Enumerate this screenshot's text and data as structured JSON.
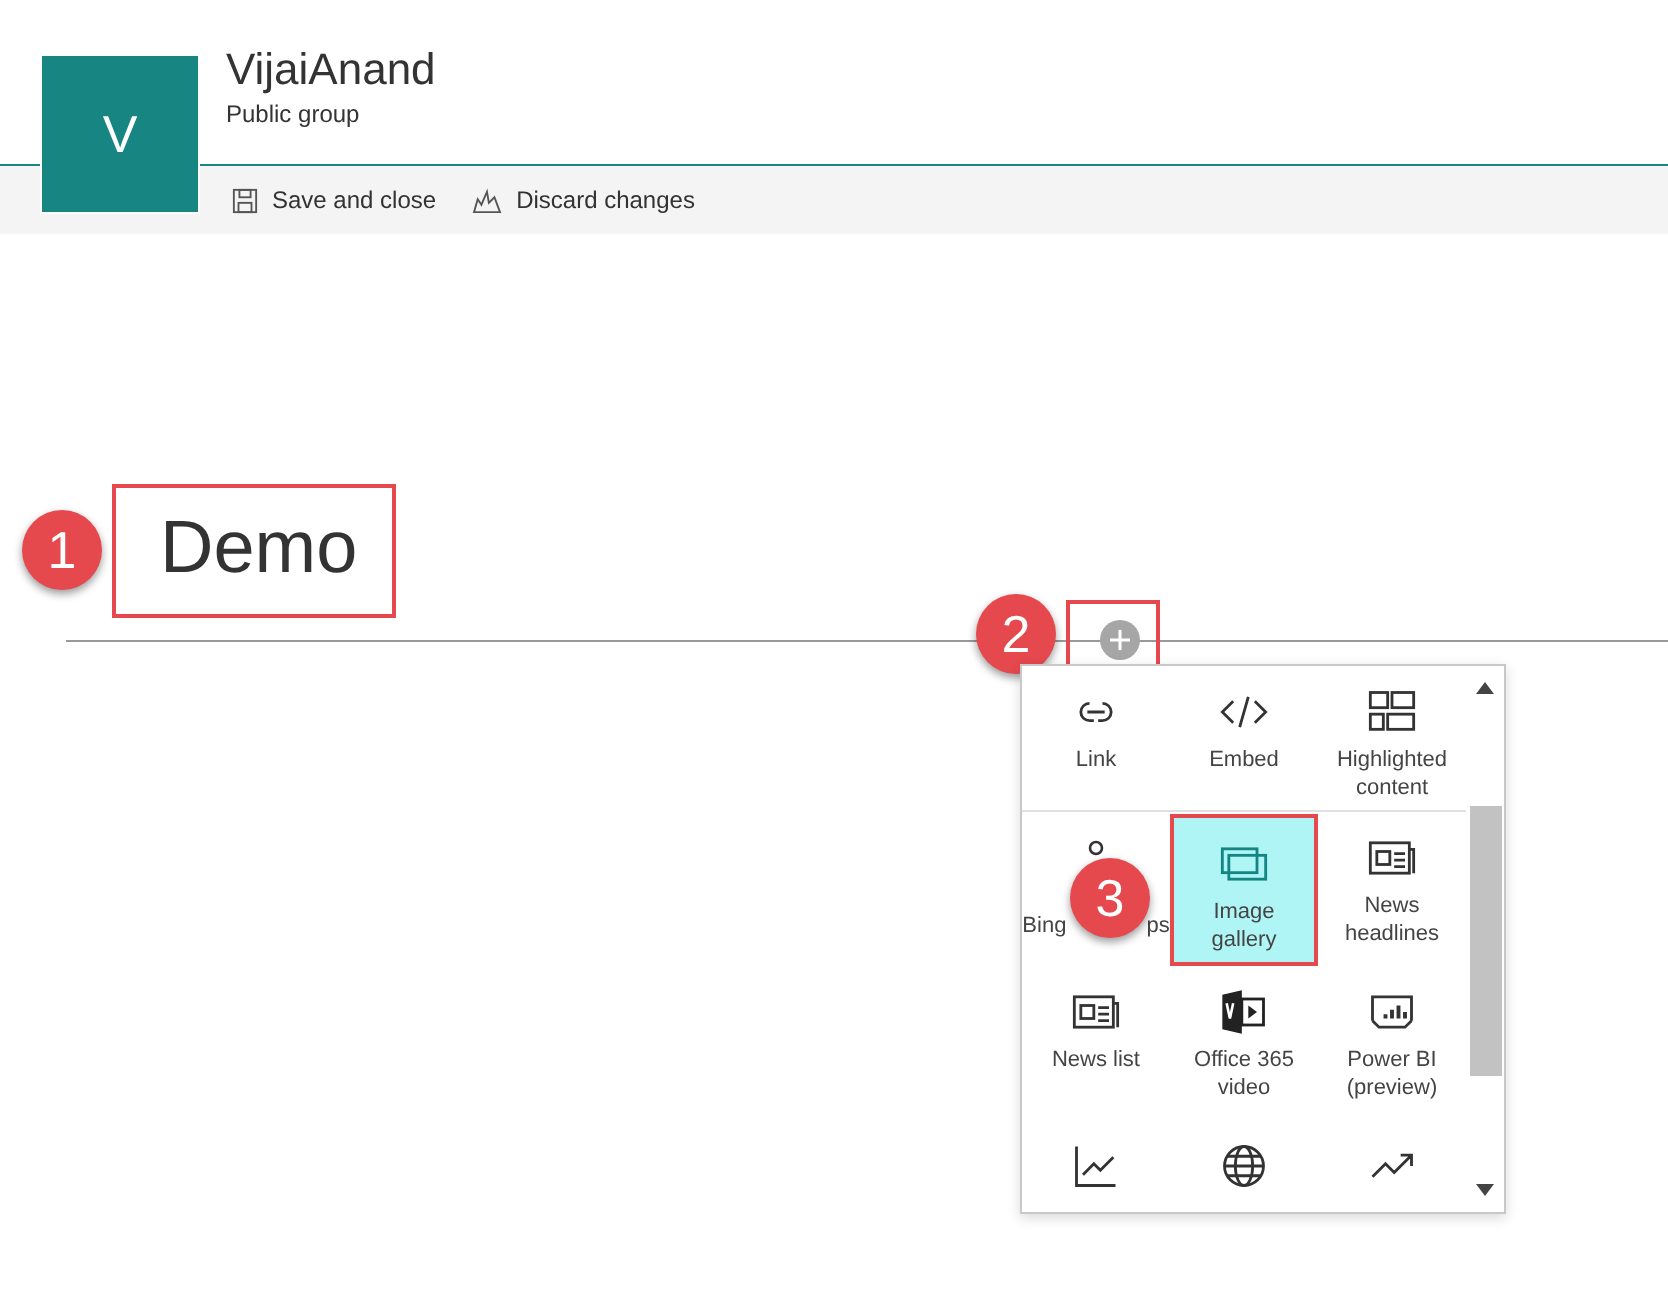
{
  "site": {
    "logo_letter": "V",
    "title": "VijaiAnand",
    "subtitle": "Public group"
  },
  "toolbar": [
    {
      "kind": "save",
      "label": "Save and close"
    },
    {
      "kind": "discard",
      "label": "Discard changes"
    }
  ],
  "page_title": "Demo",
  "callouts": [
    "1",
    "2",
    "3"
  ],
  "toolbox": {
    "tiles": [
      {
        "kind": "link",
        "label": "Link",
        "selected": false
      },
      {
        "kind": "embed",
        "label": "Embed",
        "selected": false
      },
      {
        "kind": "highlight",
        "label": "Highlighted content",
        "selected": false
      },
      {
        "kind": "pin",
        "label": "Bing",
        "label_end": "ps",
        "selected": false
      },
      {
        "kind": "gallery",
        "label": "Image gallery",
        "selected": true
      },
      {
        "kind": "news",
        "label": "News headlines",
        "selected": false
      },
      {
        "kind": "news",
        "label": "News list",
        "selected": false
      },
      {
        "kind": "video",
        "label": "Office 365 video",
        "selected": false
      },
      {
        "kind": "powerbi",
        "label": "Power BI (preview)",
        "selected": false
      },
      {
        "kind": "chart",
        "selected": false
      },
      {
        "kind": "globe",
        "selected": false
      },
      {
        "kind": "trend",
        "selected": false
      }
    ]
  }
}
